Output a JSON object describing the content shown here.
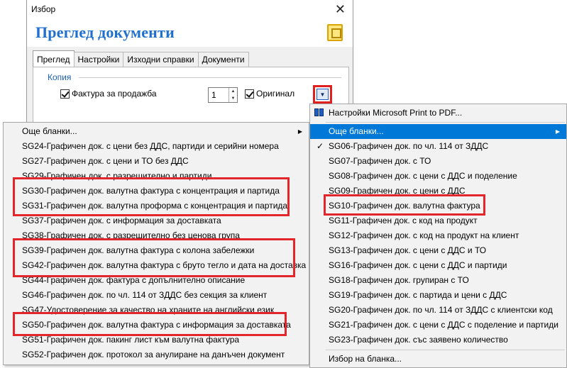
{
  "window": {
    "title": "Избор",
    "close_label": "✕",
    "header_title": "Преглед документи"
  },
  "tabs": [
    "Преглед",
    "Настройки",
    "Изходни справки",
    "Документи"
  ],
  "panel": {
    "group_label": "Копия",
    "invoice_checkbox_label": "Фактура за продажба",
    "copies_value": "1",
    "original_checkbox_label": "Оригинал",
    "dropdown_glyph": "▼"
  },
  "left_menu": {
    "more_label": "Още бланки...",
    "items": [
      "SG24-Графичен док. с цени без ДДС, партиди и серийни номера",
      "SG27-Графичен док. с цени и ТО без ДДС",
      "SG29-Графичен док. с разрешително и партиди",
      "SG30-Графичен док. валутна фактура с концентрация и партида",
      "SG31-Графичен док. валутна проформа с концентрация и партида",
      "SG37-Графичен док. с информация за доставката",
      "SG38-Графичен док. с разрешително без ценова група",
      "SG39-Графичен док. валутна фактура с колона забележки",
      "SG42-Графичен док. валутна фактура с бруто тегло и дата на доставка",
      "SG44-Графичен док. фактура с допълнително описание",
      "SG46-Графичен док. по чл. 114 от ЗДДС без секция за клиент",
      "SG47-Удостоверение за качество на храните на английски език",
      "SG50-Графичен док. валутна фактура с информация за доставката",
      "SG51-Графичен док. пакинг лист към валутна фактура",
      "SG52-Графичен док. протокол за анулиране на данъчен документ"
    ]
  },
  "right_menu": {
    "printer_label": "Настройки Microsoft Print to PDF...",
    "more_label": "Още бланки...",
    "items": [
      "SG06-Графичен док. по чл. 114 от ЗДДС",
      "SG07-Графичен док. с ТО",
      "SG08-Графичен док. с цени с ДДС и поделение",
      "SG09-Графичен док. с цени с ДДС",
      "SG10-Графичен док. валутна фактура",
      "SG11-Графичен док. с код на продукт",
      "SG12-Графичен док. с код на продукт на клиент",
      "SG13-Графичен док. с цени с ДДС и ТО",
      "SG16-Графичен док. с цени с ДДС и партиди",
      "SG18-Графичен док. групиран с ТО",
      "SG19-Графичен док. с партида и цени с ДДС",
      "SG20-Графичен док. по чл. 114 от ЗДДС с клиентски код",
      "SG21-Графичен док. с цени с ДДС с поделение и партиди",
      "SG23-Графичен док. със заявено количество"
    ],
    "choose_label": "Избор на бланка..."
  },
  "colors": {
    "accent": "#0078d7",
    "title_blue": "#1f6fcf",
    "highlight_red": "#e3262b"
  }
}
